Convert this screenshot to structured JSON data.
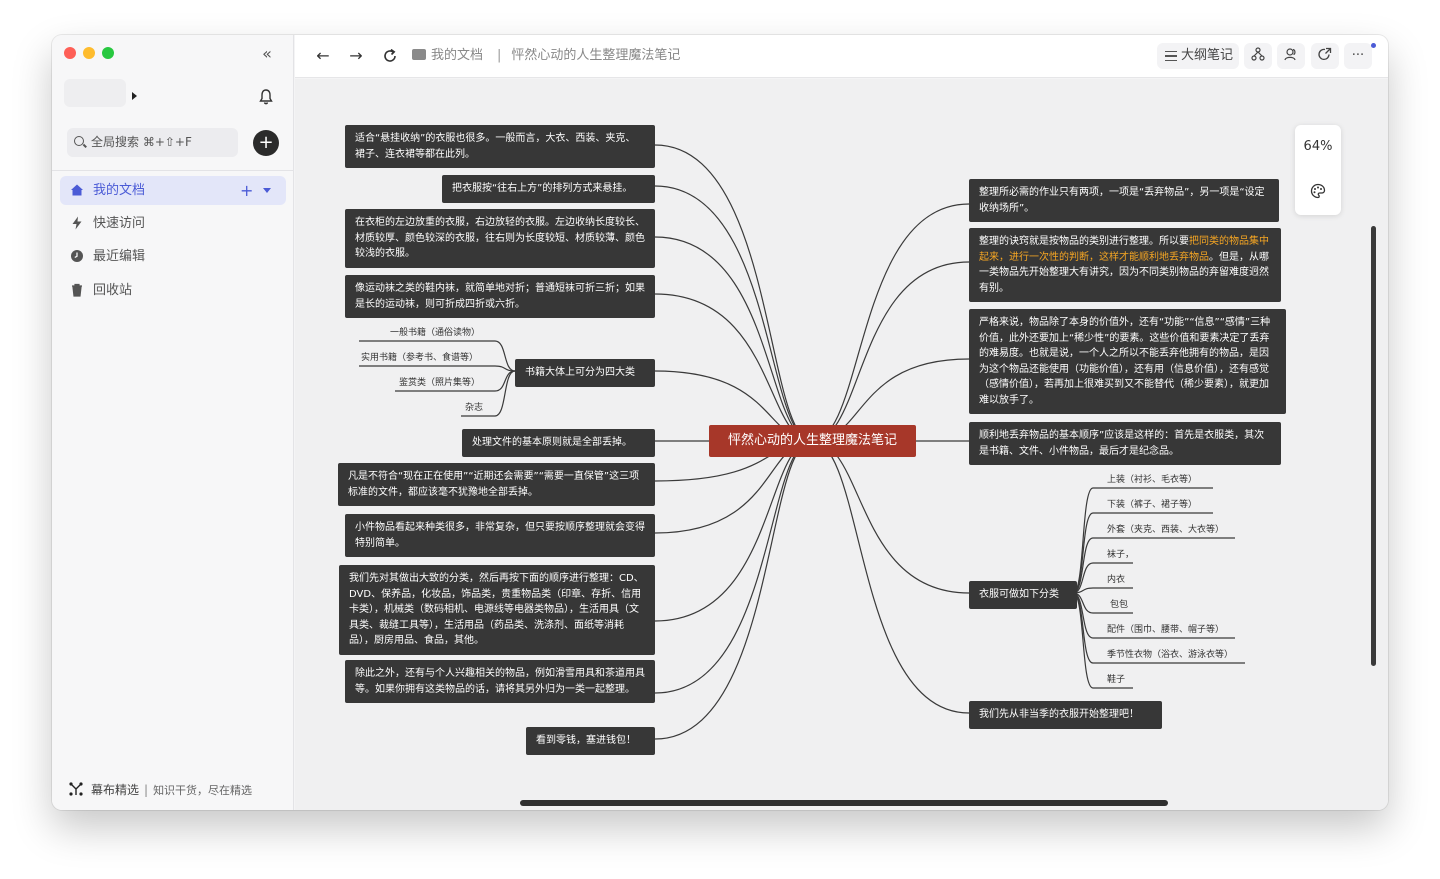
{
  "sidebar": {
    "search_placeholder": "全局搜索 ⌘+⇧+F",
    "nav": [
      {
        "label": "我的文档",
        "icon": "home-icon"
      },
      {
        "label": "快速访问",
        "icon": "lightning-icon"
      },
      {
        "label": "最近编辑",
        "icon": "clock-icon"
      },
      {
        "label": "回收站",
        "icon": "trash-icon"
      }
    ],
    "brand": {
      "name": "幕布精选",
      "slogan": "知识干货，尽在精选"
    }
  },
  "toolbar": {
    "breadcrumb": {
      "folder": "我的文档",
      "doc": "怦然心动的人生整理魔法笔记"
    },
    "outline_label": "大纲笔记",
    "more_label": "···"
  },
  "zoom": {
    "level": "64%"
  },
  "mindmap": {
    "center": "怦然心动的人生整理魔法笔记",
    "left": [
      "适合“悬挂收纳”的衣服也很多。一般而言，大衣、西装、夹克、裙子、连衣裙等都在此列。",
      "把衣服按“往右上方”的排列方式来悬挂。",
      "在衣柜的左边放重的衣服，右边放轻的衣服。左边收纳长度较长、材质较厚、颜色较深的衣服，往右则为长度较短、材质较薄、颜色较浅的衣服。",
      "像运动袜之类的鞋内袜，就简单地对折；普通短袜可折三折；如果是长的运动袜，则可折成四折或六折。",
      "书籍大体上可分为四大类",
      "处理文件的基本原则就是全部丢掉。",
      "凡是不符合“现在正在使用”“近期还会需要”“需要一直保管”这三项标准的文件，都应该毫不犹豫地全部丢掉。",
      "小件物品看起来种类很多，非常复杂，但只要按顺序整理就会变得特别简单。",
      "我们先对其做出大致的分类，然后再按下面的顺序进行整理：CD、DVD、保养品，化妆品，饰品类，贵重物品类（印章、存折、信用卡类），机械类（数码相机、电源线等电器类物品），生活用具（文具类、裁缝工具等），生活用品（药品类、洗涤剂、面纸等消耗品），厨房用品、食品，其他。",
      "除此之外，还有与个人兴趣相关的物品，例如滑雪用具和茶道用具等。如果你拥有这类物品的话，请将其另外归为一类一起整理。",
      "看到零钱，塞进钱包！"
    ],
    "books": [
      "一般书籍（通俗读物）",
      "实用书籍（参考书、食谱等）",
      "鉴赏类（照片集等）",
      "杂志"
    ],
    "right": {
      "r1": "整理所必需的作业只有两项，一项是“丢弃物品”，另一项是“设定收纳场所”。",
      "r2a": "整理的诀窍就是按物品的类别进行整理。所以要",
      "r2b": "把同类的物品集中起来，进行一次性的判断，这样才能顺利地丢弃物品",
      "r2c": "。但是，从哪一类物品先开始整理大有讲究，因为不同类别物品的弃留难度迥然有别。",
      "r3": "严格来说，物品除了本身的价值外，还有“功能”“信息”“感情”三种价值，此外还要加上“稀少性”的要素。这些价值和要素决定了丢弃的难易度。也就是说，一个人之所以不能丢弃他拥有的物品，是因为这个物品还能使用（功能价值），还有用（信息价值），还有感觉（感情价值），若再加上很难买到又不能替代（稀少要素），就更加难以放手了。",
      "r4": "顺利地丢弃物品的基本顺序”应该是这样的：首先是衣服类，其次是书籍、文件、小件物品，最后才是纪念品。",
      "r5": "衣服可做如下分类",
      "r6": "我们先从非当季的衣服开始整理吧！"
    },
    "clothes": [
      "上装（衬衫、毛衣等）",
      "下装（裤子、裙子等）",
      "外套（夹克、西装、大衣等）",
      "袜子，",
      "内衣",
      "包包",
      "配件（围巾、腰带、帽子等）",
      "季节性衣物（浴衣、游泳衣等）",
      "鞋子"
    ]
  }
}
